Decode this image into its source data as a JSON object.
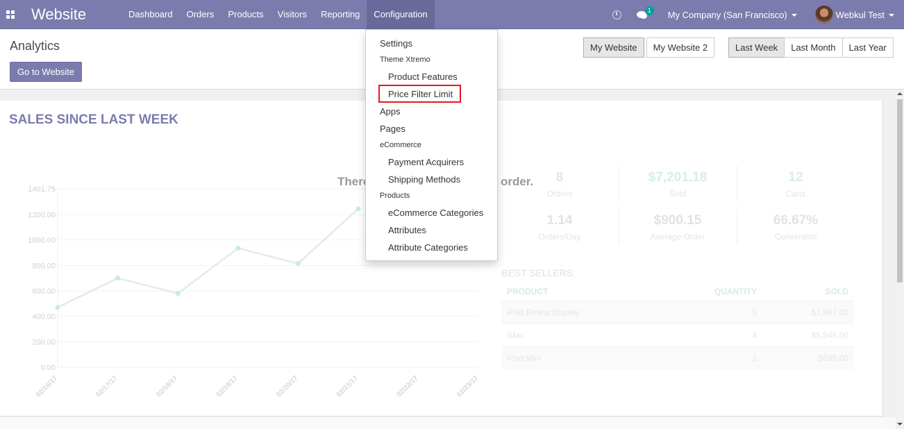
{
  "navbar": {
    "brand": "Website",
    "menu": [
      "Dashboard",
      "Orders",
      "Products",
      "Visitors",
      "Reporting",
      "Configuration"
    ],
    "active_menu": "Configuration",
    "chat_badge": "1",
    "company": "My Company (San Francisco)",
    "user": "Webkul Test",
    "bg_color": "#7c7bad"
  },
  "control_panel": {
    "title": "Analytics",
    "goto_label": "Go to Website",
    "websites": [
      "My Website",
      "My Website 2"
    ],
    "active_website": "My Website",
    "periods": [
      "Last Week",
      "Last Month",
      "Last Year"
    ],
    "active_period": "Last Week"
  },
  "dashboard": {
    "sales_title": "SALES SINCE LAST WEEK",
    "no_order_text_start": "There",
    "no_order_text_end": "order.",
    "kpis": [
      {
        "value": "8",
        "label": "Orders"
      },
      {
        "value": "$7,201.18",
        "label": "Sold"
      },
      {
        "value": "12",
        "label": "Carts"
      },
      {
        "value": "1.14",
        "label": "Orders/Day"
      },
      {
        "value": "$900.15",
        "label": "Average Order"
      },
      {
        "value": "66.67%",
        "label": "Conversion"
      }
    ],
    "best_sellers": {
      "title": "BEST SELLERS",
      "headers": {
        "product": "PRODUCT",
        "quantity": "QUANTITY",
        "sold": "SOLD"
      },
      "rows": [
        {
          "product": "iPad Retina Display",
          "quantity": "5",
          "sold": "$2,697.00"
        },
        {
          "product": "iMac",
          "quantity": "4",
          "sold": "$5,946.00"
        },
        {
          "product": "iPad Mini",
          "quantity": "1",
          "sold": "$599.00"
        }
      ]
    }
  },
  "dropdown": {
    "settings": "Settings",
    "theme_header": "Theme Xtremo",
    "product_features": "Product Features",
    "price_filter_limit": "Price Filter Limit",
    "apps": "Apps",
    "pages": "Pages",
    "ecommerce_header": "eCommerce",
    "payment_acquirers": "Payment Acquirers",
    "shipping_methods": "Shipping Methods",
    "products_header": "Products",
    "ecommerce_categories": "eCommerce Categories",
    "attributes": "Attributes",
    "attribute_categories": "Attribute Categories",
    "highlight_color": "#e8161e"
  },
  "chart_data": {
    "type": "line",
    "x": [
      "02/16/17",
      "02/17/17",
      "02/18/17",
      "02/19/17",
      "02/20/17",
      "02/21/17",
      "02/22/17",
      "02/23/17"
    ],
    "y_ticks": [
      "0.00",
      "200.00",
      "400.00",
      "600.00",
      "800.00",
      "1000.00",
      "1200.00",
      "1401.75"
    ],
    "values": [
      470,
      700,
      580,
      935,
      815,
      1245,
      null,
      null
    ],
    "ylim": [
      0,
      1401.75
    ],
    "line_color": "#e0ece8",
    "point_color": "#c6eddf"
  }
}
